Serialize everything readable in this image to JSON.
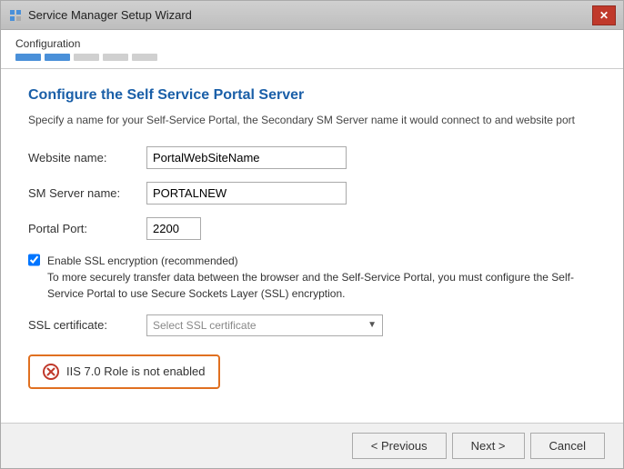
{
  "window": {
    "title": "Service Manager Setup Wizard",
    "close_label": "✕"
  },
  "breadcrumb": {
    "label": "Configuration",
    "steps": [
      {
        "active": true
      },
      {
        "active": true
      },
      {
        "active": false
      },
      {
        "active": false
      },
      {
        "active": false
      }
    ]
  },
  "form": {
    "section_title": "Configure the Self Service Portal Server",
    "section_desc": "Specify a name for your Self-Service Portal, the Secondary SM Server name it would connect to and website port",
    "website_label": "Website name:",
    "website_value": "PortalWebSiteName",
    "server_label": "SM Server name:",
    "server_value": "PORTALNEW",
    "port_label": "Portal Port:",
    "port_value": "2200",
    "ssl_checkbox_label": "Enable SSL encryption (recommended)",
    "ssl_checkbox_desc": "To more securely transfer data between the browser and the Self-Service Portal, you must configure the Self-Service Portal to use Secure Sockets Layer (SSL) encryption.",
    "ssl_cert_label": "SSL certificate:",
    "ssl_cert_placeholder": "Select SSL certificate"
  },
  "error": {
    "message": "IIS 7.0 Role is not enabled"
  },
  "footer": {
    "previous_label": "< Previous",
    "next_label": "Next >",
    "cancel_label": "Cancel"
  }
}
